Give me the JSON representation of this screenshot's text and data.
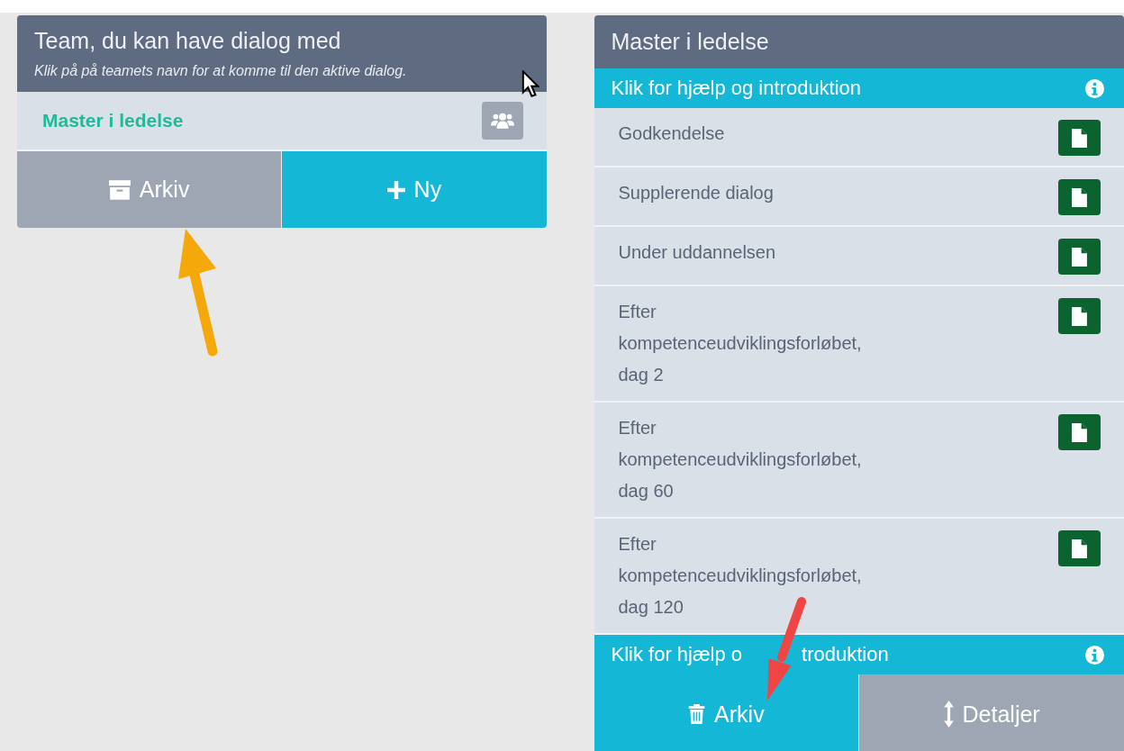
{
  "teams_panel": {
    "title": "Team, du kan have dialog med",
    "hint": "Klik på på teamets navn for at komme til den aktive dialog.",
    "teams": [
      {
        "name": "Master i ledelse"
      }
    ],
    "buttons": [
      {
        "label": "Arkiv",
        "kind": "archive"
      },
      {
        "label": "Ny",
        "kind": "new"
      }
    ]
  },
  "dialog_panel": {
    "title": "Master i ledelse",
    "help_top": "Klik for hjælp og introduktion",
    "items": [
      {
        "label": "Godkendelse"
      },
      {
        "label": "Supplerende dialog"
      },
      {
        "label": "Under uddannelsen"
      },
      {
        "label": "Efter kompetenceudviklingsforløbet, dag 2"
      },
      {
        "label": "Efter kompetenceudviklingsforløbet, dag 60"
      },
      {
        "label": "Efter kompetenceudviklingsforløbet, dag 120"
      }
    ],
    "help_bottom": [
      "Klik for hjælp o",
      "troduktion"
    ],
    "buttons": [
      {
        "label": "Arkiv",
        "kind": "delete"
      },
      {
        "label": "Detaljer",
        "kind": "details"
      }
    ]
  }
}
